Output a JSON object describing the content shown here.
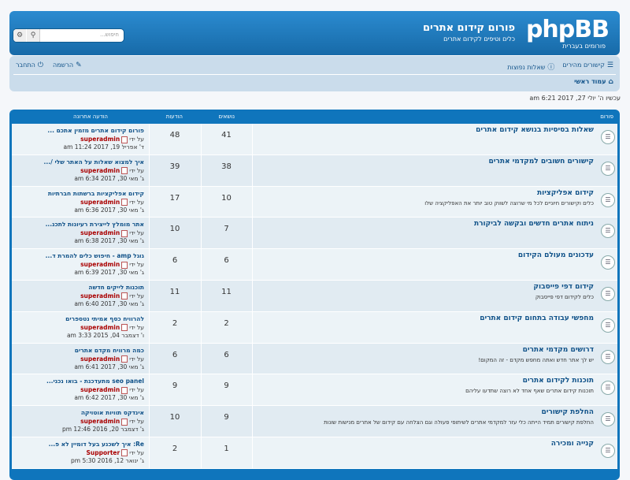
{
  "header": {
    "logo": "phpBB",
    "logo_sub": "פורומים בעברית",
    "site_title": "פורום קידום אתרים",
    "site_desc": "כלים וטיפים לקידום אתרים",
    "search_placeholder": "חיפוש..."
  },
  "nav": {
    "faq_label": "קישורים מהירים",
    "faq2_label": "שאלות נפוצות",
    "register_label": "הרשמה",
    "login_label": "התחבר",
    "breadcrumb": "עמוד ראשי"
  },
  "datetime": "עכשיו ה' יולי 27, 2017 6:21 am",
  "columns": {
    "forum": "פורום",
    "topics": "נושאים",
    "posts": "הודעות",
    "last_post": "הודעה אחרונה"
  },
  "forums": [
    {
      "name": "שאלות בסיסיות בנושא קידום אתרים",
      "desc": "",
      "topics": "41",
      "posts": "48",
      "last_title": "פורום קידום אתרים מזמין אתכם ...",
      "last_by": "superadmin",
      "last_date": "ד' אפריל 19, 2017 11:24 am"
    },
    {
      "name": "קישורים חשובים למקדמי אתרים",
      "desc": "",
      "topics": "38",
      "posts": "39",
      "last_title": "איך למצוא שאלות על האתר שלי /...",
      "last_by": "superadmin",
      "last_date": "ג' מאי 30, 2017 6:34 am"
    },
    {
      "name": "קידום אפליקציות",
      "desc": "כלים וקישורים חיוניים לכל מי שרוצה לשווק טוב יותר את האפליקציה שלו",
      "topics": "10",
      "posts": "17",
      "last_title": "קידום אפליקציות ברשתות חברתיות",
      "last_by": "superadmin",
      "last_date": "ג' מאי 30, 2017 6:36 am"
    },
    {
      "name": "ניתוח אתרים חדשים ובקשה לביקורת",
      "desc": "",
      "topics": "7",
      "posts": "10",
      "last_title": "אתר מומלץ לייצירת רעיונות לתכנ...",
      "last_by": "superadmin",
      "last_date": "ג' מאי 30, 2017 6:38 am"
    },
    {
      "name": "עדכונים מעולם הקידום",
      "desc": "",
      "topics": "6",
      "posts": "6",
      "last_title": "גוגל amp - חיפוש כלים להמרת ד...",
      "last_by": "superadmin",
      "last_date": "ג' מאי 30, 2017 6:39 am"
    },
    {
      "name": "קידום דפי פייסבוק",
      "desc": "כלים לקידום דפי פייסבוק",
      "topics": "11",
      "posts": "11",
      "last_title": "תוכנות לייקים חדשה",
      "last_by": "superadmin",
      "last_date": "ג' מאי 30, 2017 6:40 am"
    },
    {
      "name": "מחפשי עבודה בתחום קידום אתרים",
      "desc": "",
      "topics": "2",
      "posts": "2",
      "last_title": "להרוויח כסף אמיתי נטספרים",
      "last_by": "superadmin",
      "last_date": "ו' דצמבר 04, 2015 3:33 am"
    },
    {
      "name": "דרושים מקדמי אתרים",
      "desc": "יש לך אתר חדש ואתה מחפש מקדם - זה המקום!",
      "topics": "6",
      "posts": "6",
      "last_title": "כמה מרוויח מקדם אתרים",
      "last_by": "superadmin",
      "last_date": "ג' מאי 30, 2017 6:41 am"
    },
    {
      "name": "תוכנות לקידום אתרים",
      "desc": "תוכנות קידום אתרים שאף אחד לא רוצה שתדעו עליהם",
      "topics": "9",
      "posts": "9",
      "last_title": "seo panel מתעדכנת - בואו נכני...",
      "last_by": "superadmin",
      "last_date": "ג' מאי 30, 2017 6:42 am"
    },
    {
      "name": "החלפת קישורים",
      "desc": "החלפת קישורים תמיד הייתה כלי עזר למקדמי אתרים לשיתופי פעולה וגם הצלחה עם קידום של אתרים מנישות שונות",
      "topics": "9",
      "posts": "10",
      "last_title": "אינדקס תוויות אוטויקה",
      "last_by": "superadmin",
      "last_date": "ג' דצמבר 20, 2016 12:46 pm"
    },
    {
      "name": "קנייה ומכירה",
      "desc": "",
      "topics": "1",
      "posts": "2",
      "last_title": "Re: איך לשכנע בעל דומיין לא פ...",
      "last_by": "Supporter",
      "last_date": "ג' ינואר 12, 2016 5:30 pm"
    }
  ],
  "labels": {
    "by": "על ידי"
  }
}
